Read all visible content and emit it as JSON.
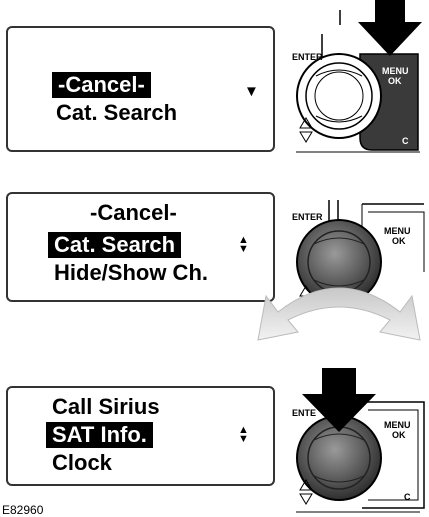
{
  "steps": [
    {
      "lines": [
        "-Cancel-",
        "Cat. Search"
      ],
      "selected_index": 0,
      "scroll": "down",
      "control": {
        "enter_label": "ENTER",
        "menu_label": "MENU",
        "ok_label": "OK",
        "c_label": "C",
        "action": "press-menu-ok"
      }
    },
    {
      "lines": [
        "-Cancel-",
        "Cat. Search",
        "Hide/Show Ch."
      ],
      "selected_index": 1,
      "scroll": "up-down",
      "control": {
        "enter_label": "ENTER",
        "menu_label": "MENU",
        "ok_label": "OK",
        "action": "rotate-knob"
      }
    },
    {
      "lines": [
        "Call Sirius",
        "SAT Info.",
        "Clock"
      ],
      "selected_index": 1,
      "scroll": "up-down",
      "control": {
        "enter_label": "ENTE",
        "menu_label": "MENU",
        "ok_label": "OK",
        "c_label": "C",
        "action": "press-knob"
      }
    }
  ],
  "figure_id": "E82960"
}
